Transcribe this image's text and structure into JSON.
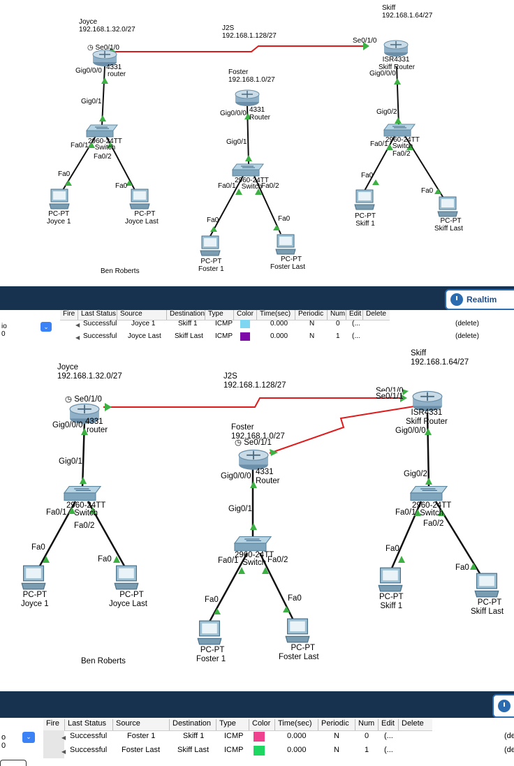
{
  "panels": [
    {
      "networks": {
        "joyce": {
          "name": "Joyce",
          "subnet": "192.168.1.32.0/27"
        },
        "j2s": {
          "name": "J2S",
          "subnet": "192.168.1.128/27"
        },
        "skiff": {
          "name": "Skiff",
          "subnet": "192.168.1.64/27"
        },
        "foster": {
          "name": "Foster",
          "subnet": "192.168.1.0/27"
        }
      },
      "routers": {
        "joyce": {
          "model": "4331",
          "name": "router"
        },
        "foster": {
          "model": "4331",
          "name": "Router"
        },
        "skiff": {
          "model": "ISR4331",
          "name": "Skiff Router"
        }
      },
      "switches": {
        "joyce": {
          "model": "2960-24TT",
          "name": "Switch"
        },
        "foster": {
          "model": "2960-24TT",
          "name": "Switch"
        },
        "skiff": {
          "model": "2960-24TT",
          "name": "Switch"
        }
      },
      "ports": {
        "joyce_se": "Se0/1/0",
        "skiff_se": "Se0/1/0",
        "joyce_gig": "Gig0/0/0",
        "joyce_sw_gig": "Gig0/1",
        "joyce_fa1": "Fa0/1",
        "joyce_fa2": "Fa0/2",
        "foster_gig": "Gig0/0/0",
        "foster_sw_gig": "Gig0/1",
        "foster_fa1": "Fa0/1",
        "foster_fa2": "Fa0/2",
        "skiff_gig": "Gig0/0/0",
        "skiff_sw_gig": "Gig0/2",
        "skiff_fa1": "Fa0/1",
        "skiff_fa2": "Fa0/2",
        "fa0": "Fa0"
      },
      "pcs": {
        "joyce1": {
          "type": "PC-PT",
          "name": "Joyce 1"
        },
        "joyceLast": {
          "type": "PC-PT",
          "name": "Joyce Last"
        },
        "foster1": {
          "type": "PC-PT",
          "name": "Foster 1"
        },
        "fosterLast": {
          "type": "PC-PT",
          "name": "Foster Last"
        },
        "skiff1": {
          "type": "PC-PT",
          "name": "Skiff 1"
        },
        "skiffLast": {
          "type": "PC-PT",
          "name": "Skiff Last"
        }
      },
      "author": "Ben Roberts"
    },
    {
      "networks": {
        "joyce": {
          "name": "Joyce",
          "subnet": "192.168.1.32.0/27"
        },
        "j2s": {
          "name": "J2S",
          "subnet": "192.168.1.128/27"
        },
        "skiff": {
          "name": "Skiff",
          "subnet": "192.168.1.64/27"
        },
        "foster": {
          "name": "Foster",
          "subnet": "192.168.1.0/27"
        }
      },
      "routers": {
        "joyce": {
          "model": "4331",
          "name": "router"
        },
        "foster": {
          "model": "4331",
          "name": "Router"
        },
        "skiff": {
          "model": "ISR4331",
          "name": "Skiff Router"
        }
      },
      "switches": {
        "joyce": {
          "model": "2960-24TT",
          "name": "Switch"
        },
        "foster": {
          "model": "2960-24TT",
          "name": "Switch"
        },
        "skiff": {
          "model": "2960-24TT",
          "name": "Switch"
        }
      },
      "ports": {
        "joyce_se": "Se0/1/0",
        "skiff_se0": "Se0/1/0",
        "skiff_se": "Se0/1/1",
        "foster_se": "Se0/1/1",
        "joyce_gig": "Gig0/0/0",
        "joyce_sw_gig": "Gig0/1",
        "joyce_fa1": "Fa0/1",
        "joyce_fa2": "Fa0/2",
        "foster_gig": "Gig0/0/0",
        "foster_sw_gig": "Gig0/1",
        "foster_fa1": "Fa0/1",
        "foster_fa2": "Fa0/2",
        "skiff_gig": "Gig0/0/0",
        "skiff_sw_gig": "Gig0/2",
        "skiff_fa1": "Fa0/1",
        "skiff_fa2": "Fa0/2",
        "fa0": "Fa0"
      },
      "pcs": {
        "joyce1": {
          "type": "PC-PT",
          "name": "Joyce 1"
        },
        "joyceLast": {
          "type": "PC-PT",
          "name": "Joyce Last"
        },
        "foster1": {
          "type": "PC-PT",
          "name": "Foster 1"
        },
        "fosterLast": {
          "type": "PC-PT",
          "name": "Foster Last"
        },
        "skiff1": {
          "type": "PC-PT",
          "name": "Skiff 1"
        },
        "skiffLast": {
          "type": "PC-PT",
          "name": "Skiff Last"
        }
      },
      "author": "Ben Roberts"
    }
  ],
  "realtime_label": "Realtim",
  "scenario_label": "io 0",
  "scenario_label2": "o 0",
  "pdu_columns": [
    "Fire",
    "Last Status",
    "Source",
    "Destination",
    "Type",
    "Color",
    "Time(sec)",
    "Periodic",
    "Num",
    "Edit",
    "Delete"
  ],
  "pdu_tables": [
    [
      {
        "status": "Successful",
        "source": "Joyce 1",
        "destination": "Skiff 1",
        "type": "ICMP",
        "color": "#7fd6f0",
        "time": "0.000",
        "periodic": "N",
        "num": "0",
        "edit": "(...",
        "delete": "(delete)"
      },
      {
        "status": "Successful",
        "source": "Joyce Last",
        "destination": "Skiff Last",
        "type": "ICMP",
        "color": "#7d0aa8",
        "time": "0.000",
        "periodic": "N",
        "num": "1",
        "edit": "(...",
        "delete": "(delete)"
      }
    ],
    [
      {
        "status": "Successful",
        "source": "Foster 1",
        "destination": "Skiff 1",
        "type": "ICMP",
        "color": "#f0418f",
        "time": "0.000",
        "periodic": "N",
        "num": "0",
        "edit": "(...",
        "delete": "(de"
      },
      {
        "status": "Successful",
        "source": "Foster Last",
        "destination": "Skiff Last",
        "type": "ICMP",
        "color": "#1ed760",
        "time": "0.000",
        "periodic": "N",
        "num": "1",
        "edit": "(...",
        "delete": "(de"
      }
    ]
  ],
  "colors": {
    "serial_link": "#e0191b",
    "ethernet_link": "#111111",
    "link_up": "#3cb043",
    "toolbar": "#16324f"
  }
}
